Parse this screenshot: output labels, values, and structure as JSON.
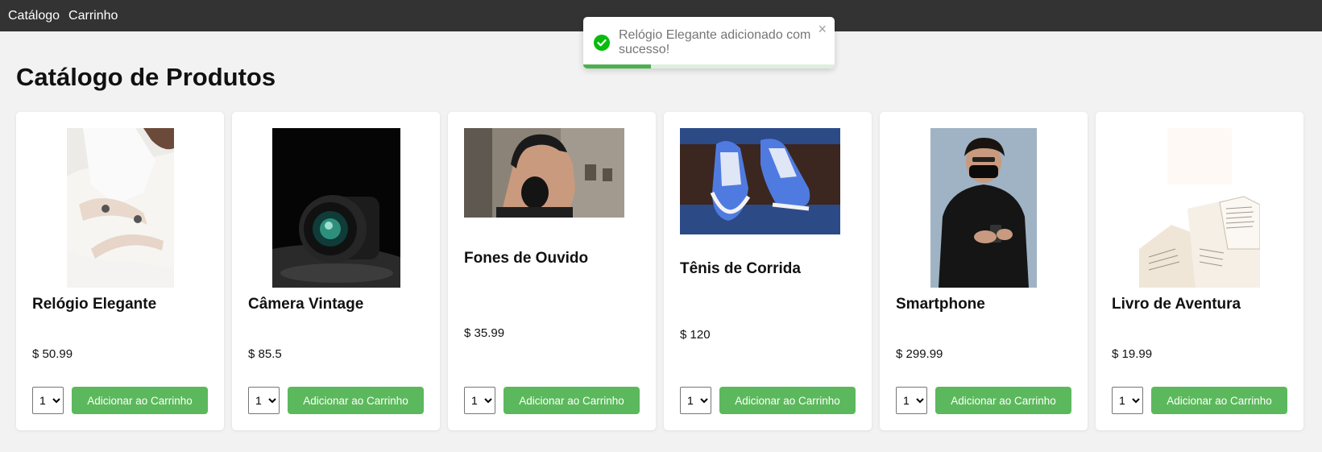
{
  "nav": {
    "catalog": "Catálogo",
    "cart": "Carrinho"
  },
  "page_title": "Catálogo de Produtos",
  "toast": {
    "message": "Relógio Elegante adicionado com sucesso!",
    "close_glyph": "×",
    "progress": 0.27,
    "color": "#4caf50"
  },
  "add_button_label": "Adicionar ao Carrinho",
  "products": [
    {
      "name": "Relógio Elegante",
      "price": "$ 50.99",
      "qty": "1",
      "image": "wristwatch-photo"
    },
    {
      "name": "Câmera Vintage",
      "price": "$ 85.5",
      "qty": "1",
      "image": "camera-lens-photo"
    },
    {
      "name": "Fones de Ouvido",
      "price": "$ 35.99",
      "qty": "1",
      "image": "headphones-photo"
    },
    {
      "name": "Tênis de Corrida",
      "price": "$ 120",
      "qty": "1",
      "image": "sneakers-photo"
    },
    {
      "name": "Smartphone",
      "price": "$ 299.99",
      "qty": "1",
      "image": "smartphone-photo"
    },
    {
      "name": "Livro de Aventura",
      "price": "$ 19.99",
      "qty": "1",
      "image": "open-book-photo"
    }
  ],
  "colors": {
    "navbar": "#333333",
    "button": "#5cb85c",
    "background": "#f2f2f2"
  }
}
